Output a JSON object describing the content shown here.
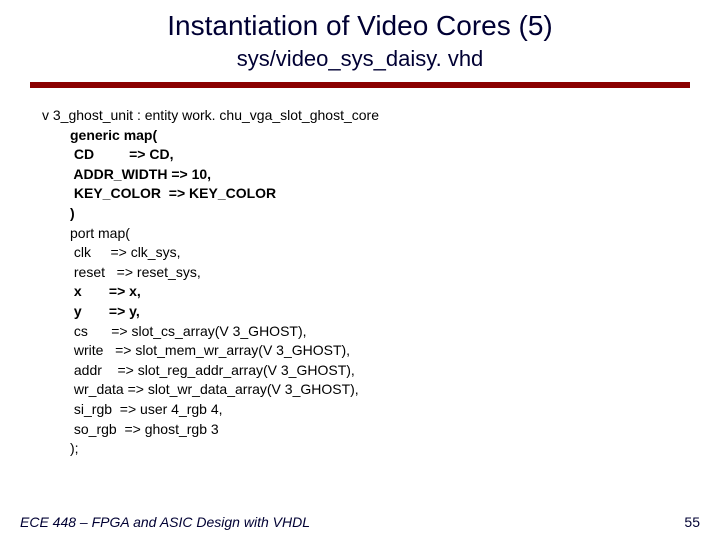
{
  "title": "Instantiation of Video Cores (5)",
  "subtitle": "sys/video_sys_daisy. vhd",
  "code": {
    "l0": "v 3_ghost_unit : entity work. chu_vga_slot_ghost_core",
    "l1": "generic map(",
    "l2": " CD         => CD,",
    "l3": " ADDR_WIDTH => 10,",
    "l4": " KEY_COLOR  => KEY_COLOR",
    "l5": ")",
    "l6": "port map(",
    "l7": " clk     => clk_sys,",
    "l8": " reset   => reset_sys,",
    "l9": " x       => x,",
    "l10": " y       => y,",
    "l11": " cs      => slot_cs_array(V 3_GHOST),",
    "l12": " write   => slot_mem_wr_array(V 3_GHOST),",
    "l13": " addr    => slot_reg_addr_array(V 3_GHOST),",
    "l14": " wr_data => slot_wr_data_array(V 3_GHOST),",
    "l15": " si_rgb  => user 4_rgb 4,",
    "l16": " so_rgb  => ghost_rgb 3",
    "l17": ");"
  },
  "footer": {
    "left": "ECE 448 – FPGA and ASIC Design with VHDL",
    "right": "55"
  }
}
